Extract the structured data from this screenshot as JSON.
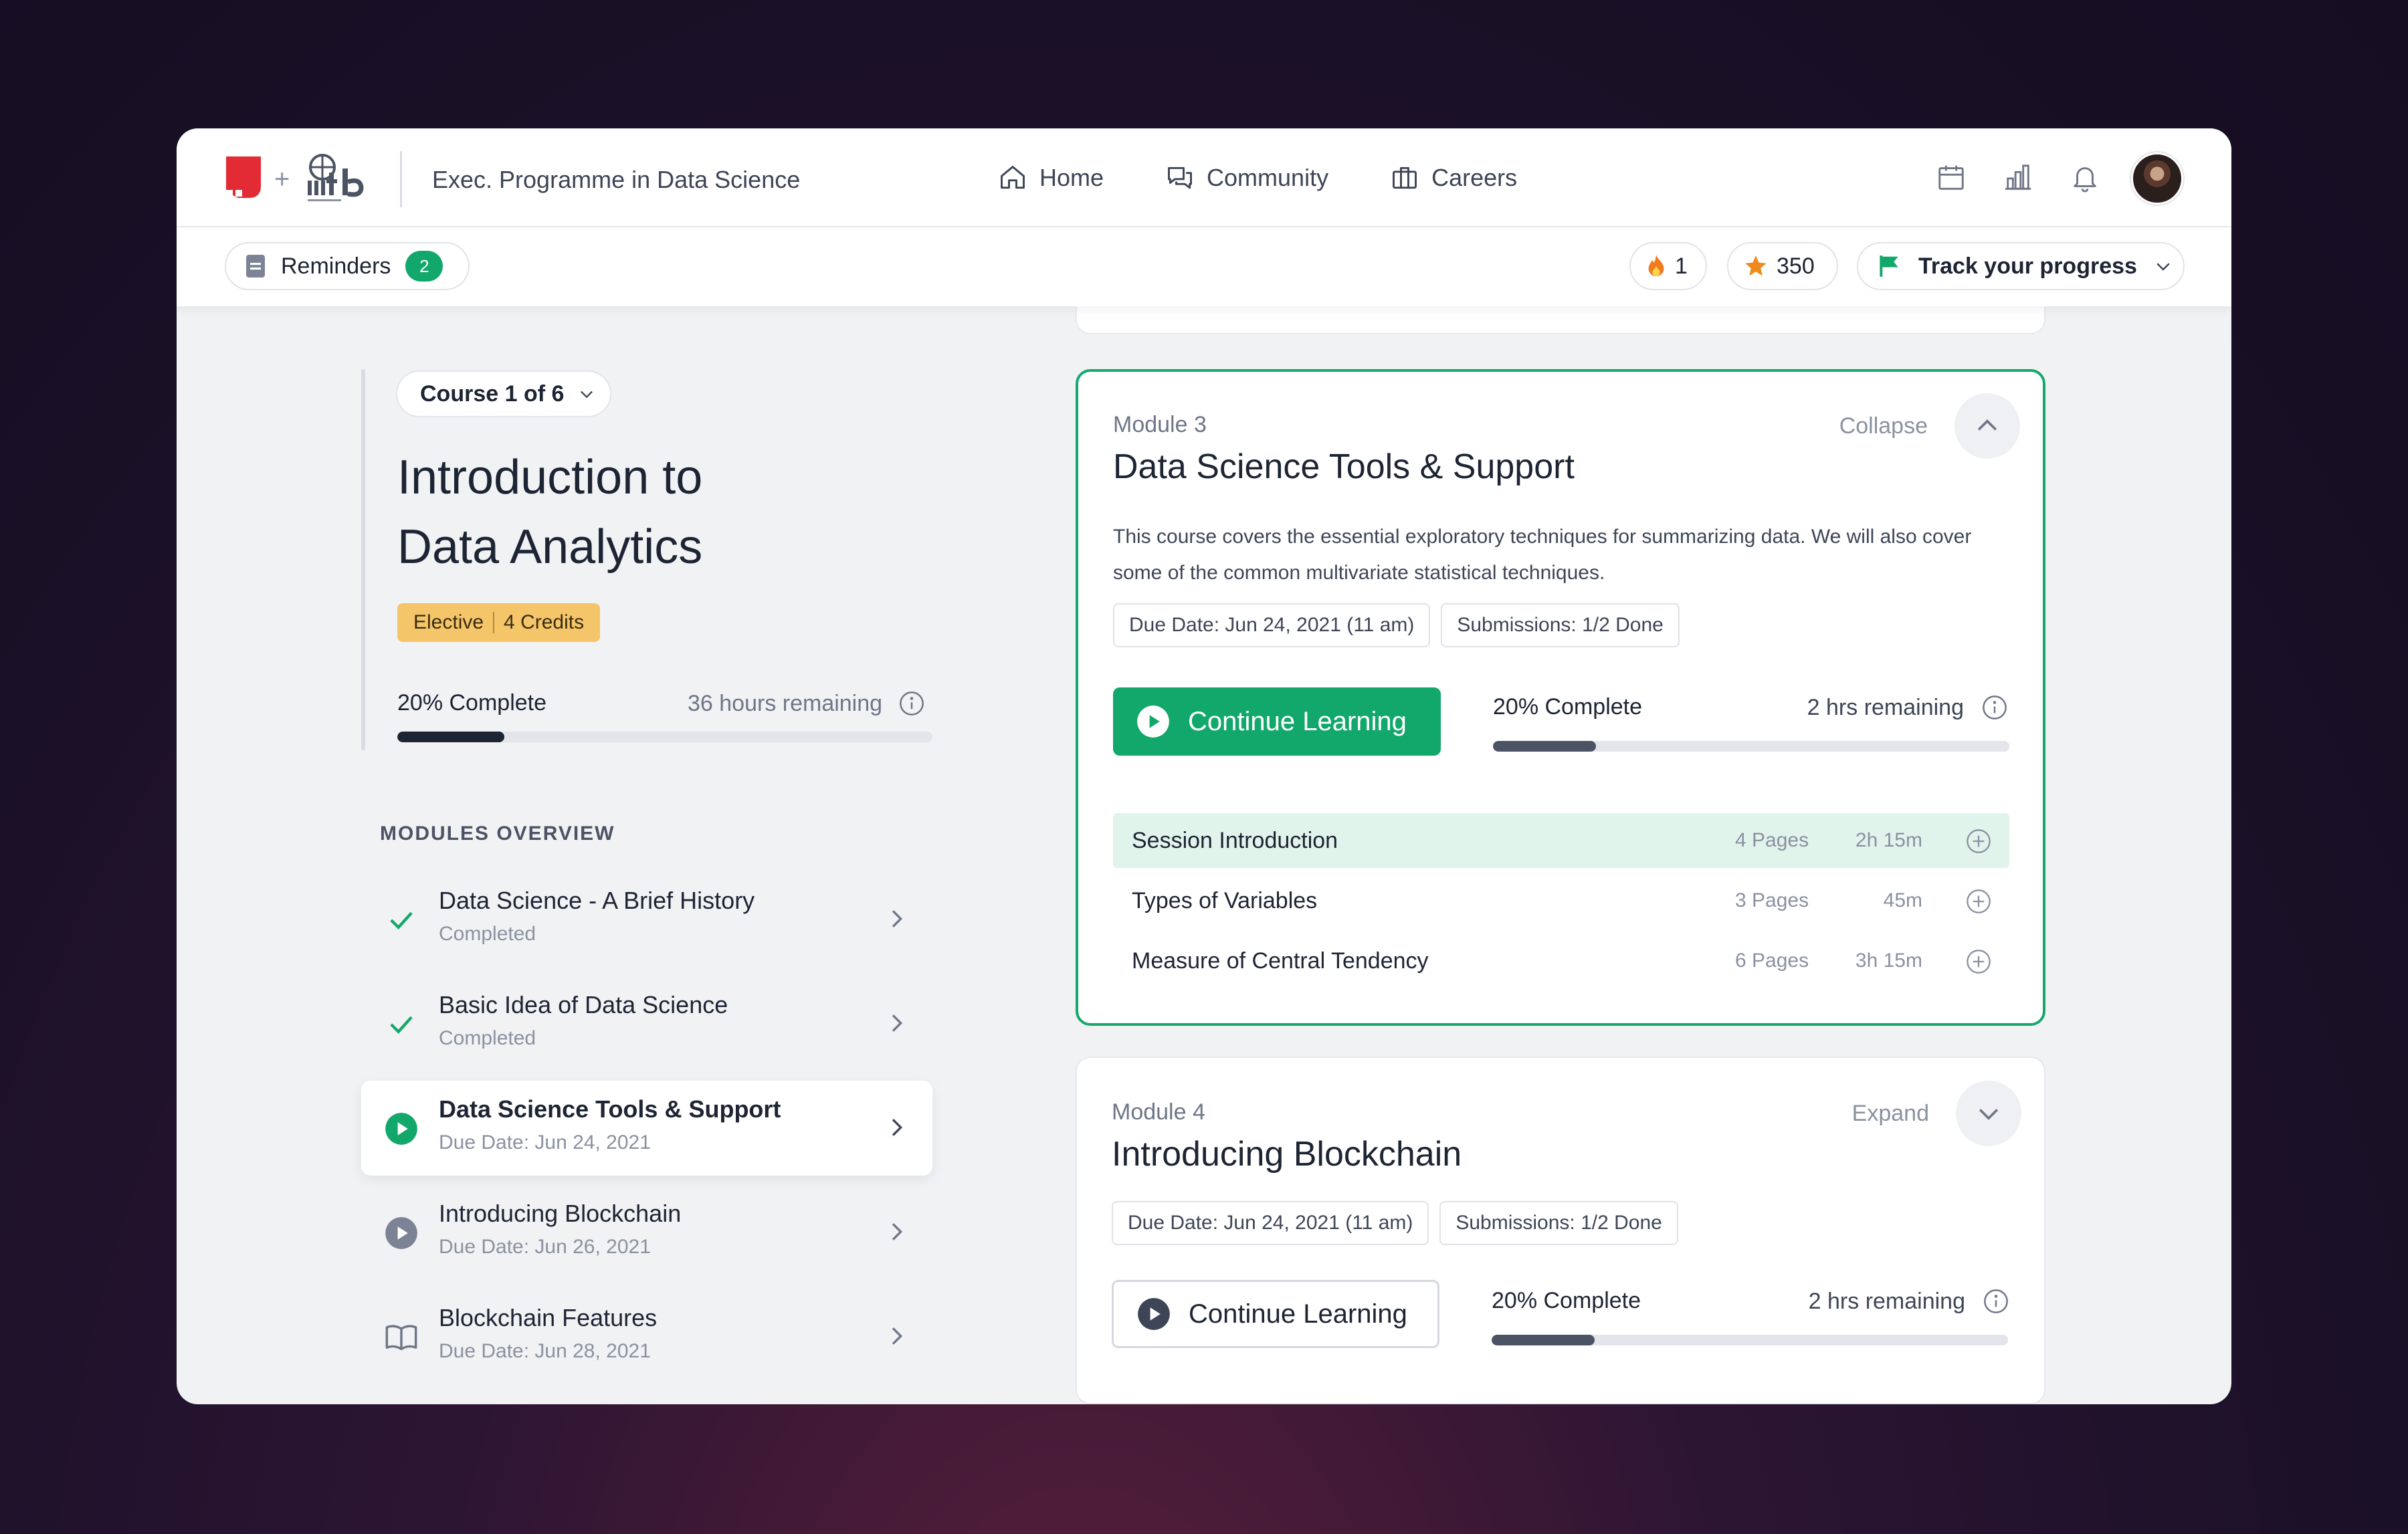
{
  "header": {
    "program_title": "Exec. Programme in Data Science",
    "nav": [
      {
        "label": "Home",
        "icon": "home-icon"
      },
      {
        "label": "Community",
        "icon": "chat-icon"
      },
      {
        "label": "Careers",
        "icon": "briefcase-icon"
      }
    ],
    "actions": [
      "calendar-icon",
      "bar-chart-icon",
      "bell-icon"
    ]
  },
  "subbar": {
    "reminders_label": "Reminders",
    "reminders_count": "2",
    "streak_count": "1",
    "stars_count": "350",
    "track_label": "Track your progress"
  },
  "course": {
    "selector_label": "Course 1 of 6",
    "title_line1": "Introduction to",
    "title_line2": "Data Analytics",
    "type": "Elective",
    "credits": "4 Credits",
    "progress_label": "20% Complete",
    "progress_fraction": 0.2,
    "remaining": "36 hours remaining"
  },
  "modules_overview": {
    "heading": "MODULES OVERVIEW",
    "items": [
      {
        "name": "Data Science - A Brief History",
        "sub": "Completed",
        "status": "completed"
      },
      {
        "name": "Basic Idea of Data Science",
        "sub": "Completed",
        "status": "completed"
      },
      {
        "name": "Data Science Tools & Support",
        "sub": "Due Date: Jun 24, 2021",
        "status": "active"
      },
      {
        "name": "Introducing Blockchain",
        "sub": "Due Date: Jun 26, 2021",
        "status": "pending"
      },
      {
        "name": "Blockchain Features",
        "sub": "Due Date: Jun 28, 2021",
        "status": "reading"
      }
    ]
  },
  "module3": {
    "label": "Module 3",
    "title": "Data Science Tools & Support",
    "toggle_label": "Collapse",
    "description": "This course covers the essential exploratory techniques for summarizing data. We will also cover some of the common multivariate statistical techniques.",
    "due_date": "Due Date: Jun 24, 2021 (11 am)",
    "submissions": "Submissions: 1/2 Done",
    "cta": "Continue Learning",
    "progress_label": "20% Complete",
    "progress_fraction": 0.2,
    "remaining": "2 hrs remaining",
    "sessions": [
      {
        "name": "Session Introduction",
        "pages": "4 Pages",
        "time": "2h 15m"
      },
      {
        "name": "Types of Variables",
        "pages": "3 Pages",
        "time": "45m"
      },
      {
        "name": "Measure of Central Tendency",
        "pages": "6 Pages",
        "time": "3h 15m"
      }
    ]
  },
  "module4": {
    "label": "Module 4",
    "title": "Introducing Blockchain",
    "toggle_label": "Expand",
    "due_date": "Due Date: Jun 24, 2021 (11 am)",
    "submissions": "Submissions: 1/2 Done",
    "cta": "Continue Learning",
    "progress_label": "20% Complete",
    "progress_fraction": 0.2,
    "remaining": "2 hrs remaining"
  },
  "colors": {
    "accent_green": "#13a86b",
    "elective_yellow": "#f5c56a",
    "text_dark": "#1d2433"
  }
}
